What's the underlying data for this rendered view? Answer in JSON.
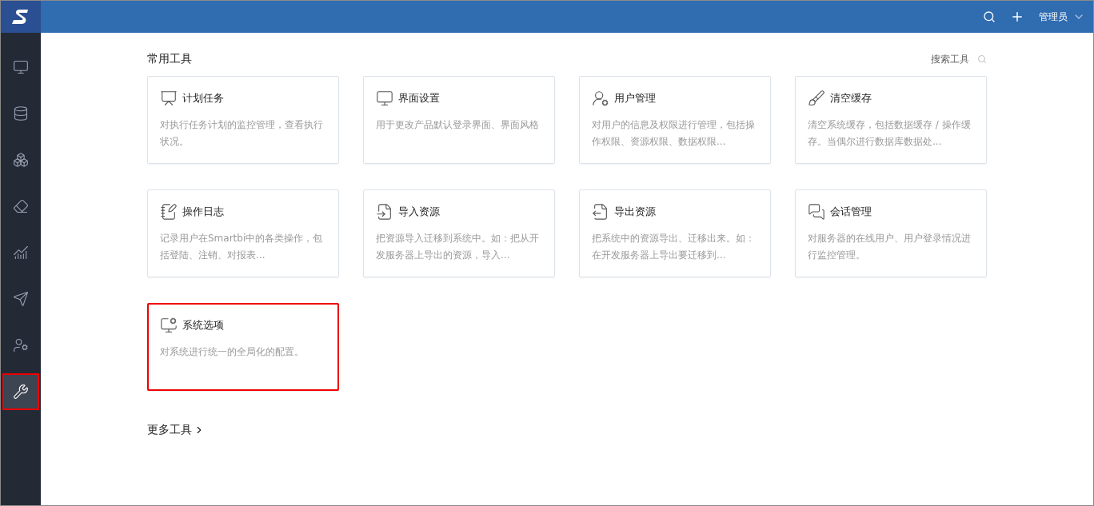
{
  "top_bar": {
    "user": "管理员"
  },
  "sidebar": {
    "items": [
      {
        "selected": false
      },
      {
        "selected": false
      },
      {
        "selected": false
      },
      {
        "selected": false
      },
      {
        "selected": false
      },
      {
        "selected": false
      },
      {
        "selected": false
      },
      {
        "selected": true
      }
    ]
  },
  "section": {
    "title": "常用工具",
    "search_label": "搜索工具"
  },
  "tools": [
    {
      "title": "计划任务",
      "description": "对执行任务计划的监控管理，查看执行状况。",
      "highlighted": false
    },
    {
      "title": "界面设置",
      "description": "用于更改产品默认登录界面、界面风格",
      "highlighted": false
    },
    {
      "title": "用户管理",
      "description": "对用户的信息及权限进行管理，包括操作权限、资源权限、数据权限...",
      "highlighted": false
    },
    {
      "title": "清空缓存",
      "description": "清空系统缓存，包括数据缓存 / 操作缓存。当偶尔进行数据库数据处...",
      "highlighted": false
    },
    {
      "title": "操作日志",
      "description": "记录用户在Smartbi中的各类操作，包括登陆、注销、对报表...",
      "highlighted": false
    },
    {
      "title": "导入资源",
      "description": "把资源导入迁移到系统中。如：把从开发服务器上导出的资源，导入...",
      "highlighted": false
    },
    {
      "title": "导出资源",
      "description": "把系统中的资源导出、迁移出来。如：在开发服务器上导出要迁移到...",
      "highlighted": false
    },
    {
      "title": "会话管理",
      "description": "对服务器的在线用户、用户登录情况进行监控管理。",
      "highlighted": false
    },
    {
      "title": "系统选项",
      "description": "对系统进行统一的全局化的配置。",
      "highlighted": true
    }
  ],
  "more_link": "更多工具"
}
